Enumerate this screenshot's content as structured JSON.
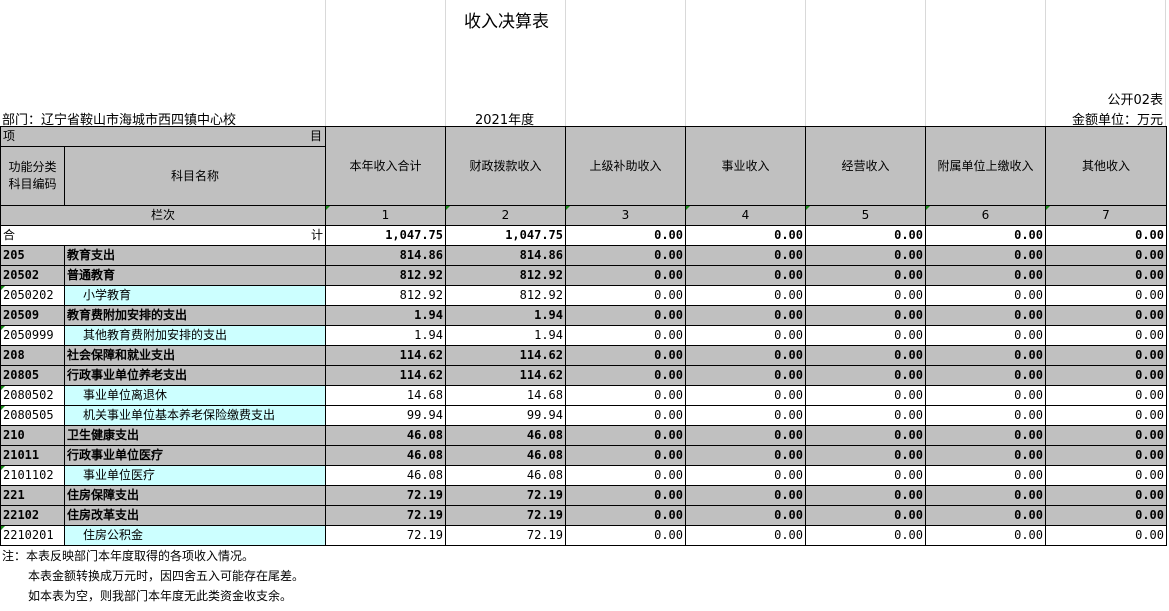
{
  "title": "收入决算表",
  "table_code": "公开02表",
  "department": "部门：辽宁省鞍山市海城市西四镇中心校",
  "year": "2021年度",
  "unit": "金额单位：万元",
  "header": {
    "item_left": "项",
    "item_right": "目",
    "func_code_line1": "功能分类",
    "func_code_line2": "科目编码",
    "subject_name": "科目名称",
    "columns": [
      "本年收入合计",
      "财政拨款收入",
      "上级补助收入",
      "事业收入",
      "经营收入",
      "附属单位上缴收入",
      "其他收入"
    ],
    "row_label": "栏次",
    "col_numbers": [
      "1",
      "2",
      "3",
      "4",
      "5",
      "6",
      "7"
    ]
  },
  "total": {
    "label_left": "合",
    "label_right": "计",
    "values": [
      "1,047.75",
      "1,047.75",
      "0.00",
      "0.00",
      "0.00",
      "0.00",
      "0.00"
    ]
  },
  "rows": [
    {
      "code": "205",
      "name": "教育支出",
      "values": [
        "814.86",
        "814.86",
        "0.00",
        "0.00",
        "0.00",
        "0.00",
        "0.00"
      ]
    },
    {
      "code": "20502",
      "name": "普通教育",
      "values": [
        "812.92",
        "812.92",
        "0.00",
        "0.00",
        "0.00",
        "0.00",
        "0.00"
      ]
    },
    {
      "code": "2050202",
      "name": "小学教育",
      "values": [
        "812.92",
        "812.92",
        "0.00",
        "0.00",
        "0.00",
        "0.00",
        "0.00"
      ]
    },
    {
      "code": "20509",
      "name": "教育费附加安排的支出",
      "values": [
        "1.94",
        "1.94",
        "0.00",
        "0.00",
        "0.00",
        "0.00",
        "0.00"
      ]
    },
    {
      "code": "2050999",
      "name": "其他教育费附加安排的支出",
      "values": [
        "1.94",
        "1.94",
        "0.00",
        "0.00",
        "0.00",
        "0.00",
        "0.00"
      ]
    },
    {
      "code": "208",
      "name": "社会保障和就业支出",
      "values": [
        "114.62",
        "114.62",
        "0.00",
        "0.00",
        "0.00",
        "0.00",
        "0.00"
      ]
    },
    {
      "code": "20805",
      "name": "行政事业单位养老支出",
      "values": [
        "114.62",
        "114.62",
        "0.00",
        "0.00",
        "0.00",
        "0.00",
        "0.00"
      ]
    },
    {
      "code": "2080502",
      "name": "事业单位离退休",
      "values": [
        "14.68",
        "14.68",
        "0.00",
        "0.00",
        "0.00",
        "0.00",
        "0.00"
      ]
    },
    {
      "code": "2080505",
      "name": "机关事业单位基本养老保险缴费支出",
      "values": [
        "99.94",
        "99.94",
        "0.00",
        "0.00",
        "0.00",
        "0.00",
        "0.00"
      ]
    },
    {
      "code": "210",
      "name": "卫生健康支出",
      "values": [
        "46.08",
        "46.08",
        "0.00",
        "0.00",
        "0.00",
        "0.00",
        "0.00"
      ]
    },
    {
      "code": "21011",
      "name": "行政事业单位医疗",
      "values": [
        "46.08",
        "46.08",
        "0.00",
        "0.00",
        "0.00",
        "0.00",
        "0.00"
      ]
    },
    {
      "code": "2101102",
      "name": "事业单位医疗",
      "values": [
        "46.08",
        "46.08",
        "0.00",
        "0.00",
        "0.00",
        "0.00",
        "0.00"
      ]
    },
    {
      "code": "221",
      "name": "住房保障支出",
      "values": [
        "72.19",
        "72.19",
        "0.00",
        "0.00",
        "0.00",
        "0.00",
        "0.00"
      ]
    },
    {
      "code": "22102",
      "name": "住房改革支出",
      "values": [
        "72.19",
        "72.19",
        "0.00",
        "0.00",
        "0.00",
        "0.00",
        "0.00"
      ]
    },
    {
      "code": "2210201",
      "name": "住房公积金",
      "values": [
        "72.19",
        "72.19",
        "0.00",
        "0.00",
        "0.00",
        "0.00",
        "0.00"
      ]
    }
  ],
  "notes": [
    "注：本表反映部门本年度取得的各项收入情况。",
    "本表金额转换成万元时，因四舍五入可能存在尾差。",
    "如本表为空，则我部门本年度无此类资金收支余。"
  ],
  "colors": {
    "header_gray": "#c0c0c0",
    "leaf_cyan": "#ccffff",
    "marker_green": "#1a8a1a"
  }
}
